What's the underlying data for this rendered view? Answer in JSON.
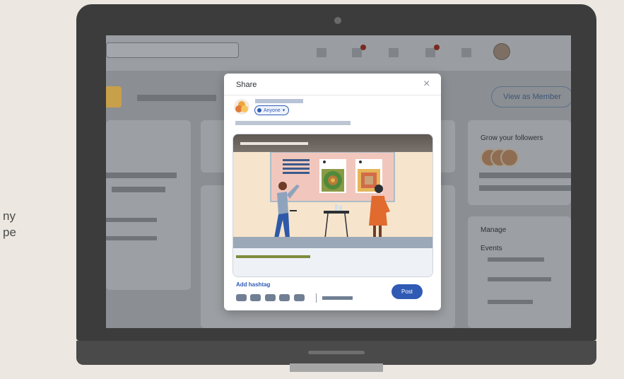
{
  "background": {
    "text_lines": [
      "ny",
      "pe"
    ]
  },
  "linkedin": {
    "view_as_member": "View as Member",
    "grow_title": "Grow your followers",
    "manage_title": "Manage",
    "events_label": "Events"
  },
  "share_modal": {
    "title": "Share",
    "close_glyph": "×",
    "visibility": "Anyone",
    "visibility_caret": "▾",
    "add_hashtag": "Add hashtag",
    "post_label": "Post"
  },
  "colors": {
    "accent": "#2f5bb5",
    "screen_overlay": "#8b8f93",
    "laptop": "#3c3c3c"
  }
}
